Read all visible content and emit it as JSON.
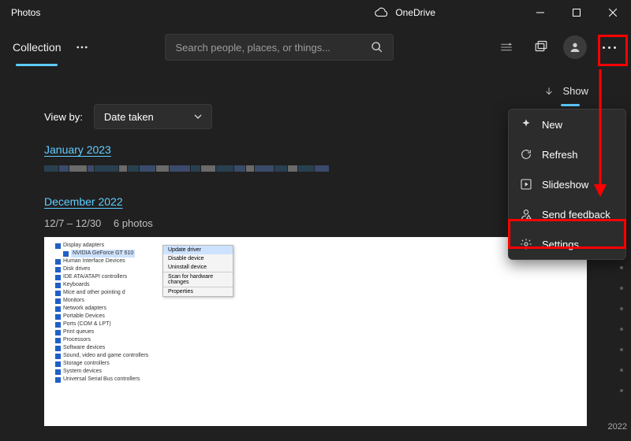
{
  "window": {
    "title": "Photos",
    "cloud": "OneDrive"
  },
  "toolbar": {
    "tab": "Collection",
    "search_placeholder": "Search people, places, or things..."
  },
  "viewby": {
    "label": "View by:",
    "value": "Date taken"
  },
  "sections": {
    "jan": {
      "label": "January 2023"
    },
    "dec": {
      "label": "December 2022",
      "range": "12/7 – 12/30",
      "count": "6 photos"
    }
  },
  "thumb": {
    "tree": [
      "Display adapters",
      "NVIDIA GeForce GT 610",
      "Human Interface Devices",
      "Disk drives",
      "IDE ATA/ATAPI controllers",
      "Keyboards",
      "Mice and other pointing d",
      "Monitors",
      "Network adapters",
      "Portable Devices",
      "Ports (COM & LPT)",
      "Print queues",
      "Processors",
      "Software devices",
      "Sound, video and game controllers",
      "Storage controllers",
      "System devices",
      "Universal Serial Bus controllers"
    ],
    "ctx": [
      "Update driver",
      "Disable device",
      "Uninstall device",
      "Scan for hardware changes",
      "Properties"
    ]
  },
  "show_button": "Show",
  "menu": {
    "new": "New",
    "refresh": "Refresh",
    "slideshow": "Slideshow",
    "feedback": "Send feedback",
    "settings": "Settings"
  },
  "year_marker": "2022"
}
